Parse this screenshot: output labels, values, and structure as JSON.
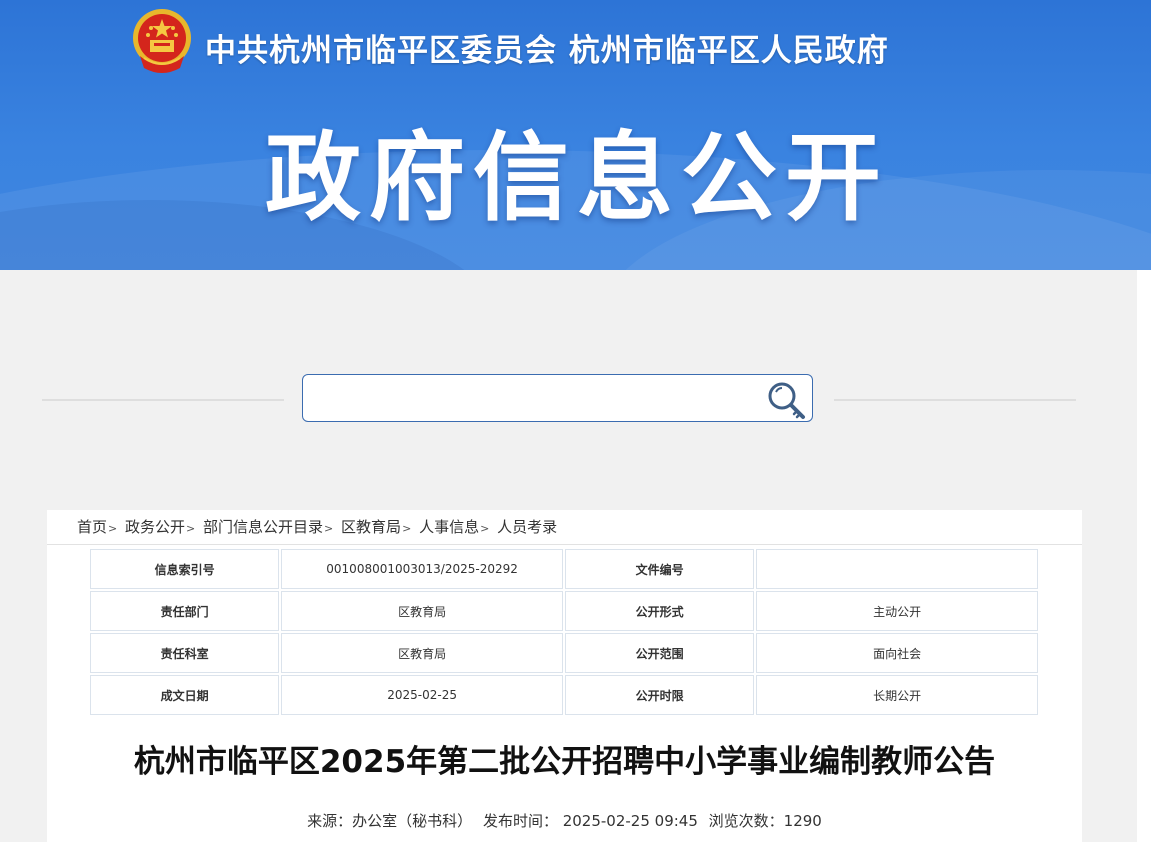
{
  "header": {
    "org_title": "中共杭州市临平区委员会  杭州市临平区人民政府",
    "site_title": "政府信息公开",
    "emblem_icon": "national-emblem-icon"
  },
  "search": {
    "placeholder": "",
    "value": "",
    "icon": "search-icon"
  },
  "breadcrumb": [
    "首页",
    "政务公开",
    "部门信息公开目录",
    "区教育局",
    "人事信息",
    "人员考录"
  ],
  "breadcrumb_separator": ">",
  "meta_table": {
    "rows": [
      {
        "k1": "信息索引号",
        "v1": "001008001003013/2025-20292",
        "k2": "文件编号",
        "v2": ""
      },
      {
        "k1": "责任部门",
        "v1": "区教育局",
        "k2": "公开形式",
        "v2": "主动公开"
      },
      {
        "k1": "责任科室",
        "v1": "区教育局",
        "k2": "公开范围",
        "v2": "面向社会"
      },
      {
        "k1": "成文日期",
        "v1": "2025-02-25",
        "k2": "公开时限",
        "v2": "长期公开"
      }
    ]
  },
  "article": {
    "title": "杭州市临平区2025年第二批公开招聘中小学事业编制教师公告",
    "source": "来源：办公室（秘书科）",
    "publish_time": "发布时间：  2025-02-25 09:45",
    "views": "浏览次数：1290"
  },
  "colors": {
    "banner_blue": "#2d74d6",
    "search_border": "#3b6cb0",
    "page_bg": "#f1f1f1"
  }
}
